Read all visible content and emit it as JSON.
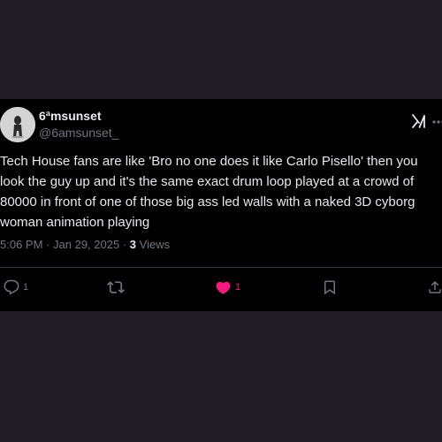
{
  "tweet": {
    "display_name": "6ªmsunset",
    "handle": "@6amsunset_",
    "text": "Tech House fans are like 'Bro no one does it like Carlo Pisello' then you\nlook the guy up and it's the same exact drum loop played at a crowd of\n80000 in front of one of those big ass led walls with a naked 3D cyborg\nwoman animation playing",
    "time": "5:06 PM",
    "separator": "·",
    "date": "Jan 29, 2025",
    "views_count": "3",
    "views_label": "Views"
  },
  "actions": {
    "reply_count": "1",
    "retweet_count": "",
    "like_count": "1"
  },
  "icons": {
    "avatar": "avatar-silhouette",
    "grok": "grok-icon",
    "more": "more-icon",
    "reply": "reply-icon",
    "retweet": "retweet-icon",
    "like": "heart-icon",
    "bookmark": "bookmark-icon",
    "share": "share-icon"
  },
  "colors": {
    "background": "#1f1c24",
    "card": "#000000",
    "text": "#e7e9ea",
    "secondary": "#71767b",
    "like": "#f91880",
    "divider": "#2f3336"
  }
}
